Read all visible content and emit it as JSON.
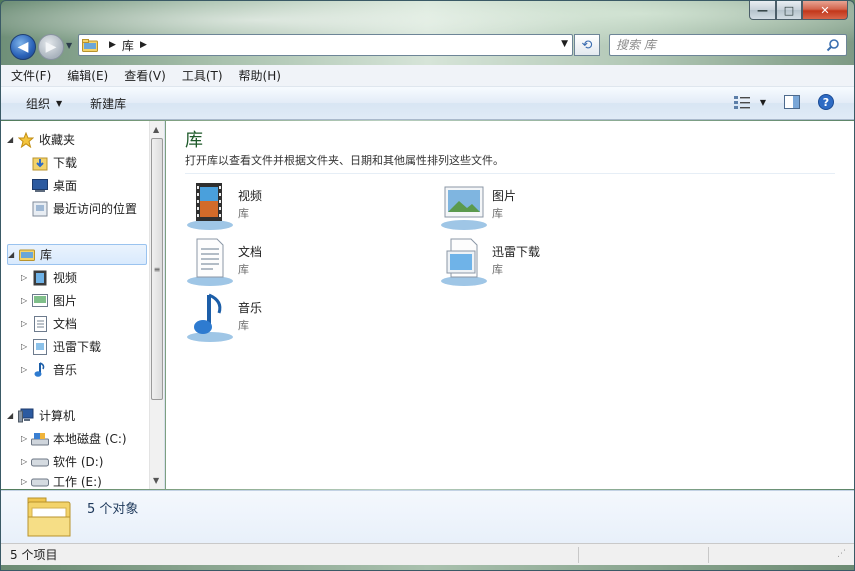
{
  "window": {
    "caption_min": "—",
    "caption_max": "□",
    "caption_close": "✕"
  },
  "address": {
    "crumb": "库",
    "icon": "library-folder-icon"
  },
  "search": {
    "placeholder": "搜索 库"
  },
  "menu": [
    "文件(F)",
    "编辑(E)",
    "查看(V)",
    "工具(T)",
    "帮助(H)"
  ],
  "toolbar": {
    "organize": "组织",
    "new_library": "新建库"
  },
  "nav": {
    "favorites": "收藏夹",
    "downloads": "下载",
    "desktop": "桌面",
    "recent": "最近访问的位置",
    "libraries": "库",
    "videos": "视频",
    "pictures": "图片",
    "documents": "文档",
    "xunlei": "迅雷下载",
    "music": "音乐",
    "computer": "计算机",
    "drive_c": "本地磁盘 (C:)",
    "drive_d": "软件 (D:)",
    "drive_e": "工作 (E:)"
  },
  "main": {
    "title": "库",
    "subtitle": "打开库以查看文件并根据文件夹、日期和其他属性排列这些文件。",
    "items": [
      {
        "name": "视频",
        "kind": "库",
        "icon": "video-library-icon"
      },
      {
        "name": "图片",
        "kind": "库",
        "icon": "picture-library-icon"
      },
      {
        "name": "文档",
        "kind": "库",
        "icon": "document-library-icon"
      },
      {
        "name": "迅雷下载",
        "kind": "库",
        "icon": "download-library-icon"
      },
      {
        "name": "音乐",
        "kind": "库",
        "icon": "music-library-icon"
      }
    ]
  },
  "details": {
    "count": "5 个对象"
  },
  "status": {
    "items": "5 个项目"
  },
  "colors": {
    "accent": "#1e5a2a",
    "selection": "#d9eafd",
    "toolbar": "#e3ecf7"
  }
}
